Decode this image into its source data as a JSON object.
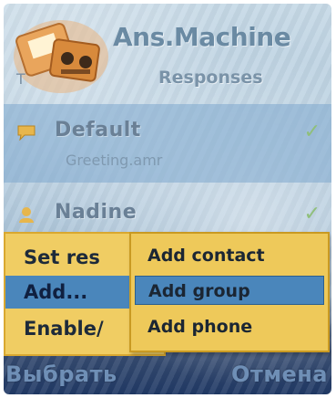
{
  "header": {
    "title": "Ans.Machine",
    "tab": "Responses"
  },
  "list": {
    "items": [
      {
        "name": "Default",
        "subtitle": "Greeting.amr",
        "checked": true
      },
      {
        "name": "Nadine",
        "checked": true
      }
    ]
  },
  "options_menu": {
    "items": [
      {
        "label": "Set res"
      },
      {
        "label": "Add..."
      },
      {
        "label": "Enable/"
      }
    ],
    "selected_index": 1
  },
  "submenu": {
    "items": [
      {
        "label": "Add contact"
      },
      {
        "label": "Add group"
      },
      {
        "label": "Add phone"
      }
    ],
    "selected_index": 1
  },
  "softkeys": {
    "left": "Выбрать",
    "right": "Отмена"
  },
  "colors": {
    "menu_bg": "#f0cd63",
    "selection": "#4a86bb",
    "softkey_text": "#6f8fb6"
  }
}
